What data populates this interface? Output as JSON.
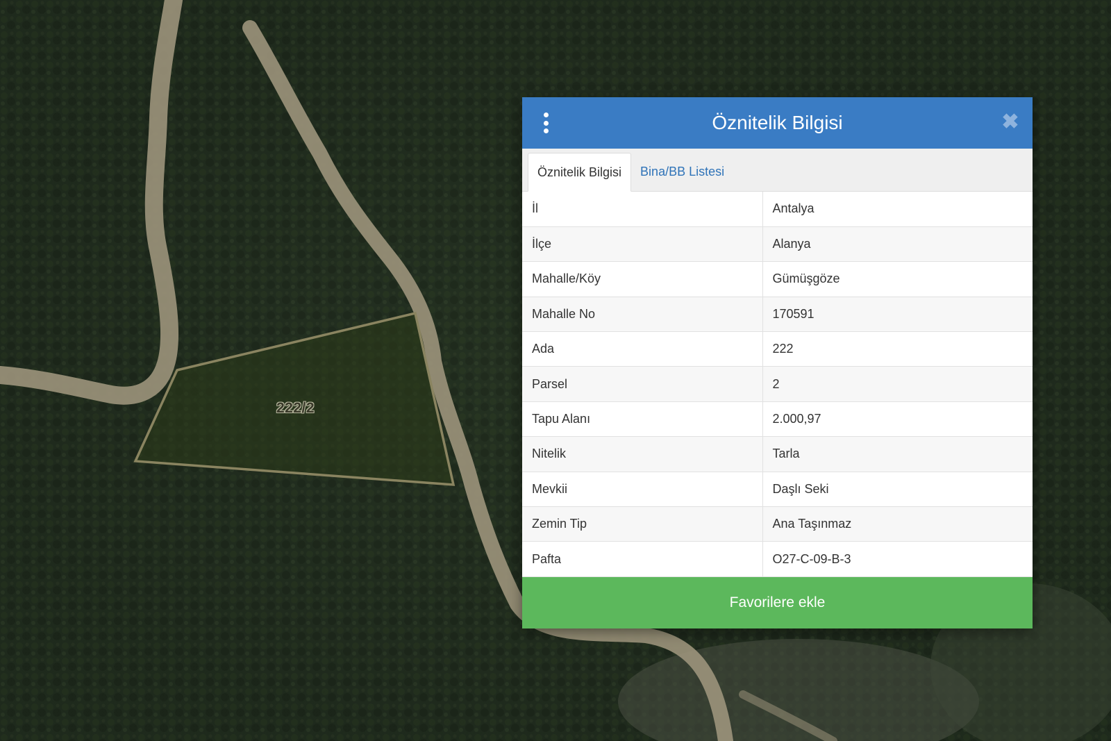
{
  "map": {
    "parcel_label": "222/2",
    "colors": {
      "forest": "#1f2b1d",
      "road": "#a39a80",
      "parcel_outline": "#8a8460"
    }
  },
  "panel": {
    "title": "Öznitelik Bilgisi",
    "menu_icon": "vertical-dots-icon",
    "close_icon": "close-icon",
    "tabs": [
      {
        "label": "Öznitelik Bilgisi",
        "active": true
      },
      {
        "label": "Bina/BB Listesi",
        "active": false
      }
    ],
    "rows": [
      {
        "key": "İl",
        "value": "Antalya"
      },
      {
        "key": "İlçe",
        "value": "Alanya"
      },
      {
        "key": "Mahalle/Köy",
        "value": "Gümüşgöze"
      },
      {
        "key": "Mahalle No",
        "value": "170591"
      },
      {
        "key": "Ada",
        "value": "222"
      },
      {
        "key": "Parsel",
        "value": "2"
      },
      {
        "key": "Tapu Alanı",
        "value": "2.000,97"
      },
      {
        "key": "Nitelik",
        "value": "Tarla"
      },
      {
        "key": "Mevkii",
        "value": "Daşlı Seki"
      },
      {
        "key": "Zemin Tip",
        "value": "Ana Taşınmaz"
      },
      {
        "key": "Pafta",
        "value": "O27-C-09-B-3"
      }
    ],
    "favorite_button": "Favorilere ekle",
    "colors": {
      "header": "#3a7cc4",
      "button": "#5cb85c",
      "tab_link": "#2f73b8"
    }
  }
}
